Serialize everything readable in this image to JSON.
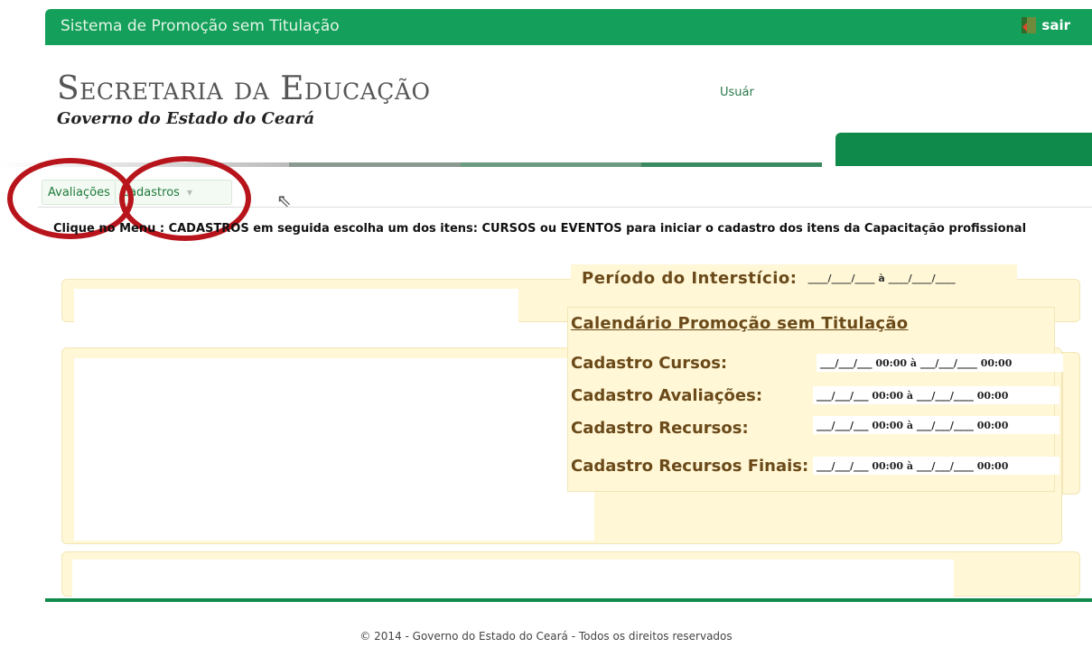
{
  "topbar": {
    "title": "Sistema de Promoção sem Titulação",
    "logout_label": "sair",
    "logout_icon": "door-exit-icon"
  },
  "brand": {
    "name": "Secretaria da Educação",
    "subtitle": "Governo do Estado do Ceará"
  },
  "user": {
    "label": "Usuár"
  },
  "menu": {
    "items": [
      {
        "label": "Avaliações"
      },
      {
        "label": "Cadastros"
      }
    ]
  },
  "instruction": "Clique no Menu : CADASTROS em seguida escolha um dos itens: CURSOS ou EVENTOS para iniciar o cadastro dos itens da Capacitação profissional",
  "periodo": {
    "label": "Período do Interstício:",
    "value": "____/____/____ à ____/____/____"
  },
  "calendario": {
    "title": "Calendário Promoção sem Titulação",
    "rows": [
      {
        "label": "Cadastro Cursos:",
        "value": "___/___/___ 00:00 à ___/___/____ 00:00"
      },
      {
        "label": "Cadastro Avaliações:",
        "value": "___/___/___ 00:00 à ___/___/____ 00:00"
      },
      {
        "label": "Cadastro Recursos:",
        "value": "___/___/___ 00:00 à ___/___/____ 00:00"
      },
      {
        "label": "Cadastro Recursos Finais:",
        "value": "___/___/___ 00:00 à ___/___/____ 00:00"
      }
    ]
  },
  "footer": "© 2014 - Governo do Estado do Ceará - Todos os direitos reservados",
  "colors": {
    "brand_green": "#14a05a",
    "dark_green": "#0f8a4a",
    "panel_yellow": "#fff7d6",
    "label_brown": "#6b4a1a",
    "annotation_red": "#b8141b"
  }
}
